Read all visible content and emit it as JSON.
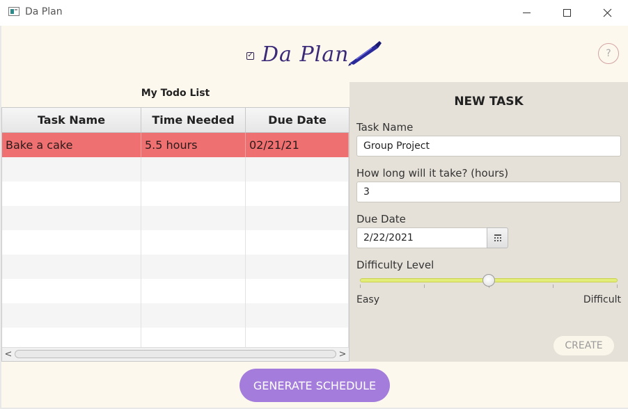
{
  "window": {
    "title": "Da Plan",
    "controls": {
      "minimize": "minimize",
      "maximize": "maximize",
      "close": "close"
    }
  },
  "header": {
    "logo_text": "Da Plan",
    "logo_check": "✓",
    "help_label": "?"
  },
  "todo_list": {
    "title": "My Todo List",
    "columns": [
      "Task Name",
      "Time Needed",
      "Due Date"
    ],
    "rows": [
      {
        "name": "Bake a cake",
        "time": "5.5 hours",
        "due": "02/21/21",
        "selected": true
      }
    ],
    "scroll_left": "<",
    "scroll_right": ">"
  },
  "new_task": {
    "title": "NEW TASK",
    "task_name_label": "Task Name",
    "task_name_value": "Group Project",
    "duration_label": "How long will it take? (hours)",
    "duration_value": "3",
    "due_date_label": "Due Date",
    "due_date_value": "2/22/2021",
    "difficulty_label": "Difficulty Level",
    "difficulty_level": 0.5,
    "difficulty_min_label": "Easy",
    "difficulty_max_label": "Difficult",
    "create_label": "CREATE"
  },
  "footer": {
    "generate_label": "GENERATE SCHEDULE"
  },
  "colors": {
    "app_background": "#fdf8ee",
    "panel_background": "#e5e1d8",
    "selected_row": "#ef7070",
    "generate_button": "#a47cdb",
    "slider_track": "#e3ee7a",
    "logo": "#3a2a78"
  }
}
